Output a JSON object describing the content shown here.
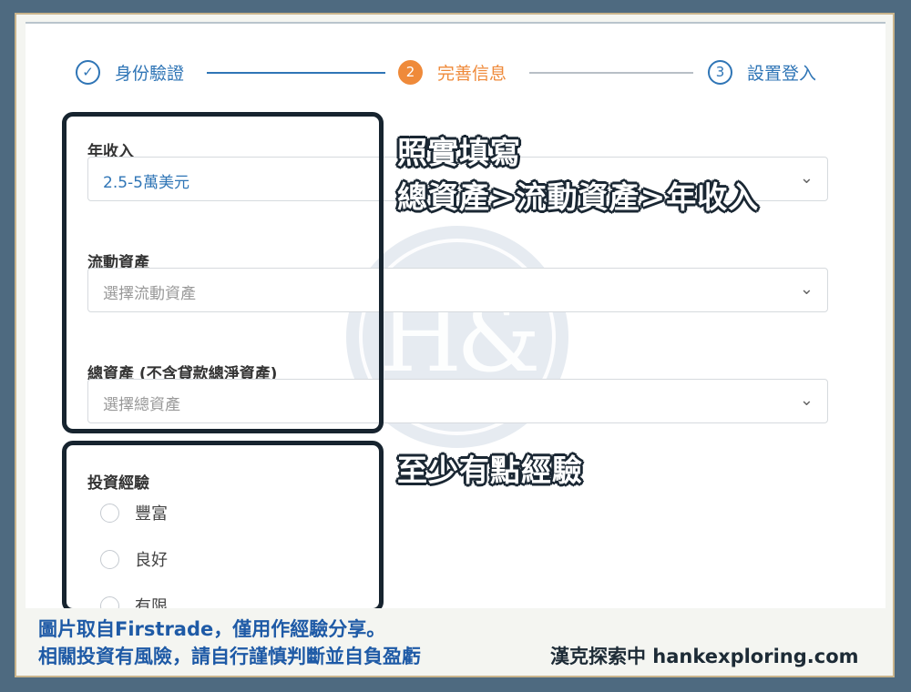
{
  "stepper": {
    "steps": [
      {
        "marker": "✓",
        "label": "身份驗證",
        "state": "done"
      },
      {
        "marker": "2",
        "label": "完善信息",
        "state": "active"
      },
      {
        "marker": "3",
        "label": "設置登入",
        "state": "pending"
      }
    ]
  },
  "watermark": {
    "text": "H&"
  },
  "form": {
    "annual_income": {
      "label": "年收入",
      "value": "2.5-5萬美元"
    },
    "liquid_assets": {
      "label": "流動資產",
      "placeholder": "選擇流動資產"
    },
    "total_assets": {
      "label": "總資產 (不含貸款總淨資產)",
      "placeholder": "選擇總資產"
    },
    "experience": {
      "label": "投資經驗",
      "options": [
        "豐富",
        "良好",
        "有限"
      ]
    }
  },
  "annotations": {
    "note1_line1": "照實填寫",
    "note1_line2": "總資產>流動資產>年收入",
    "note2": "至少有點經驗"
  },
  "footer": {
    "line1": "圖片取自Firstrade，僅用作經驗分享。",
    "line2": "相關投資有風險，請自行謹慎判斷並自負盈虧",
    "brand": "漢克探索中 hankexploring.com"
  },
  "colors": {
    "accent_blue": "#2f75b6",
    "accent_orange": "#ef8a3a",
    "footer_blue": "#1e5aa6",
    "frame": "#4e6a80"
  },
  "icons": {
    "dropdown": "chevron-down-icon",
    "step_done": "check-icon"
  }
}
